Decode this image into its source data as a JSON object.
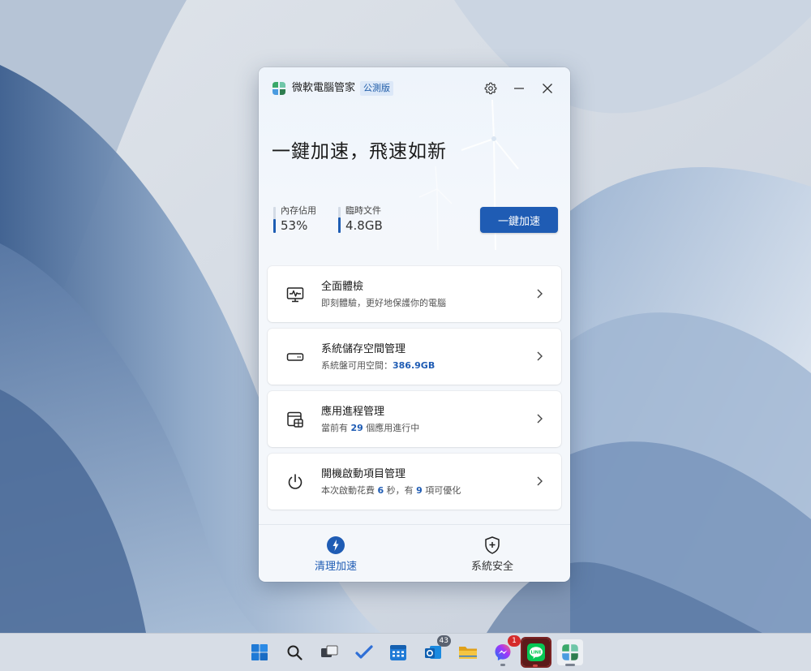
{
  "app": {
    "name": "微軟電腦管家",
    "badge": "公測版",
    "headline": "一鍵加速，飛速如新",
    "boost_button": "一鍵加速",
    "memory": {
      "label": "內存佔用",
      "value": "53%",
      "fraction": 0.53
    },
    "temp_files": {
      "label": "臨時文件",
      "value": "4.8GB",
      "fraction": 0.6
    },
    "cards": [
      {
        "icon": "health-check-icon",
        "title": "全面體檢",
        "sub_parts": [
          {
            "text": "即刻體驗，更好地保護你的電腦"
          }
        ]
      },
      {
        "icon": "storage-drive-icon",
        "title": "系統儲存空間管理",
        "sub_parts": [
          {
            "text": "系統盤可用空間："
          },
          {
            "text": "386.9GB",
            "bold": true
          }
        ]
      },
      {
        "icon": "process-window-icon",
        "title": "應用進程管理",
        "sub_parts": [
          {
            "text": "當前有 "
          },
          {
            "text": "29",
            "bold": true
          },
          {
            "text": " 個應用進行中"
          }
        ]
      },
      {
        "icon": "power-icon",
        "title": "開機啟動項目管理",
        "sub_parts": [
          {
            "text": "本次啟動花費 "
          },
          {
            "text": "6",
            "bold": true
          },
          {
            "text": " 秒，有 "
          },
          {
            "text": "9",
            "bold": true
          },
          {
            "text": " 項可優化"
          }
        ]
      }
    ],
    "nav": {
      "clean": "清理加速",
      "security": "系統安全"
    },
    "accent_color": "#1f5cb4"
  },
  "taskbar": {
    "items": [
      {
        "name": "start-icon"
      },
      {
        "name": "search-icon"
      },
      {
        "name": "task-view-icon"
      },
      {
        "name": "todo-icon"
      },
      {
        "name": "calendar-icon"
      },
      {
        "name": "outlook-icon",
        "badge": "43"
      },
      {
        "name": "file-explorer-icon"
      },
      {
        "name": "messenger-icon",
        "badge": "1"
      },
      {
        "name": "line-app-icon"
      },
      {
        "name": "pc-manager-icon"
      }
    ]
  }
}
